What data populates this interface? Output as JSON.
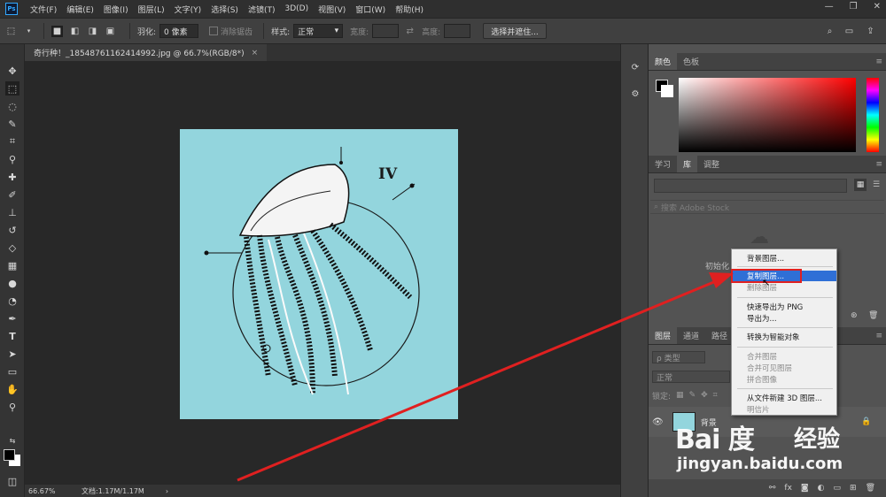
{
  "menubar": {
    "app_icon": "Ps",
    "items": [
      "文件(F)",
      "编辑(E)",
      "图像(I)",
      "图层(L)",
      "文字(Y)",
      "选择(S)",
      "滤镜(T)",
      "3D(D)",
      "视图(V)",
      "窗口(W)",
      "帮助(H)"
    ]
  },
  "options": {
    "feather_label": "羽化:",
    "feather_value": "0 像素",
    "antialias_label": "消除锯齿",
    "style_label": "样式:",
    "style_value": "正常",
    "width_label": "宽度:",
    "height_label": "高度:",
    "select_mask_button": "选择并遮住..."
  },
  "document": {
    "tab_title": "奇行种！_185487611624149​92.jpg @ 66.7%(RGB/8*)",
    "close_glyph": "×",
    "artwork_text": "IV"
  },
  "status": {
    "zoom": "66.67%",
    "doc_size": "文档:1.17M/1.17M"
  },
  "color_panel": {
    "tabs": [
      "颜色",
      "色板"
    ]
  },
  "library_panel": {
    "tabs": [
      "学习",
      "库",
      "调整"
    ],
    "search_placeholder": "搜索 Adobe Stock",
    "init_text": "初始化"
  },
  "layers_panel": {
    "tabs": [
      "图层",
      "通道",
      "路径"
    ],
    "filter_label": "ρ 类型",
    "blend_mode": "正常",
    "lock_label": "锁定:",
    "layer_name": "背景"
  },
  "context_menu": {
    "items": [
      {
        "label": "背景图层...",
        "disabled": false
      },
      {
        "label": "复制图层...",
        "disabled": false,
        "highlighted": true
      },
      {
        "label": "删除图层",
        "disabled": true
      },
      {
        "label": "快速导出为 PNG",
        "disabled": false
      },
      {
        "label": "导出为...",
        "disabled": false
      },
      {
        "label": "转换为智能对象",
        "disabled": false
      },
      {
        "label": "合并图层",
        "disabled": true
      },
      {
        "label": "合并可见图层",
        "disabled": true
      },
      {
        "label": "拼合图像",
        "disabled": true
      },
      {
        "label": "从文件新建 3D 图层...",
        "disabled": false
      },
      {
        "label": "明信片",
        "disabled": true
      }
    ]
  },
  "watermark": {
    "logo_text": "Bai 度",
    "cn_text": "经验",
    "url_text": "jingyan.baidu.com"
  },
  "colors": {
    "highlight": "#2f6fd6",
    "annotation_red": "#e02020",
    "artwork_bg": "#93d5dd"
  }
}
